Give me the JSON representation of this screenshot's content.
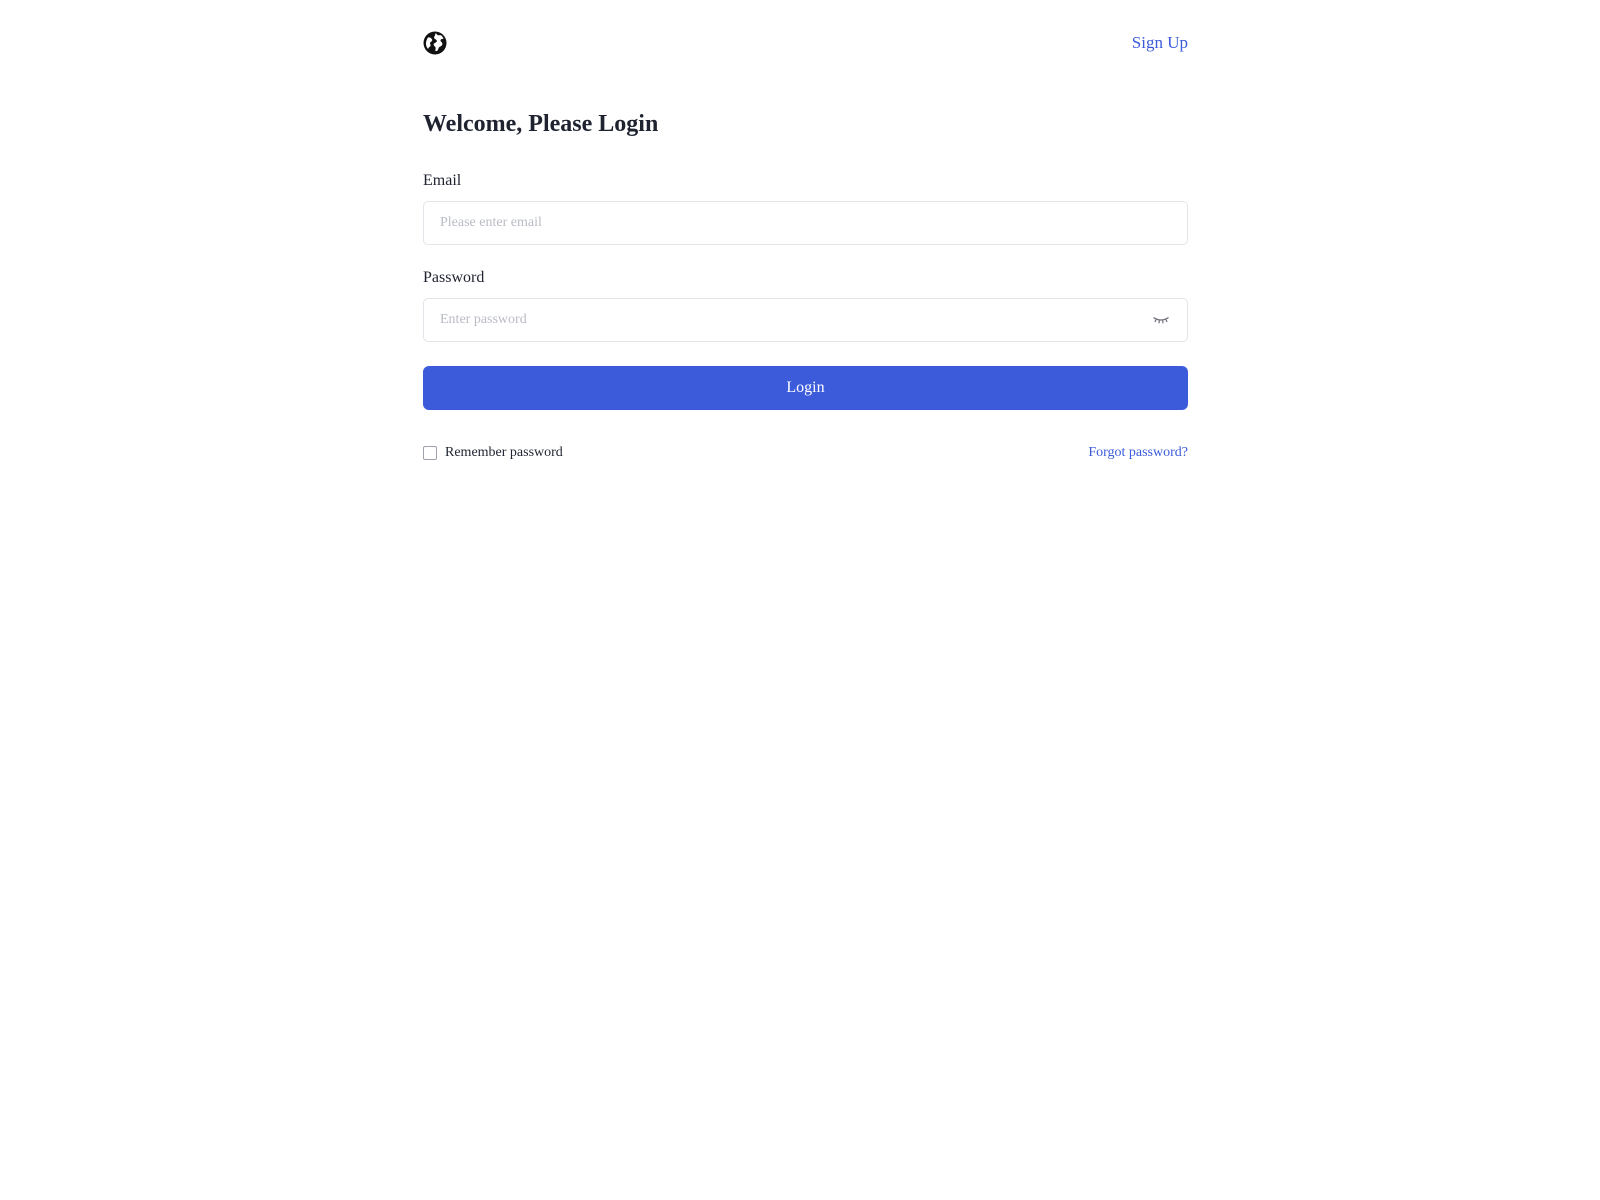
{
  "header": {
    "logo_icon": "globe-icon",
    "signup_label": "Sign Up"
  },
  "form": {
    "title": "Welcome, Please Login",
    "email": {
      "label": "Email",
      "value": "",
      "placeholder": "Please enter email"
    },
    "password": {
      "label": "Password",
      "value": "",
      "placeholder": "Enter password",
      "toggle_icon": "eye-closed-icon"
    },
    "login_label": "Login",
    "remember": {
      "label": "Remember password",
      "checked": false
    },
    "forgot_label": "Forgot password?"
  },
  "colors": {
    "accent": "#3b5bdb",
    "text": "#1f2330",
    "placeholder": "#b9bcc4",
    "border": "#e3e5ea"
  }
}
